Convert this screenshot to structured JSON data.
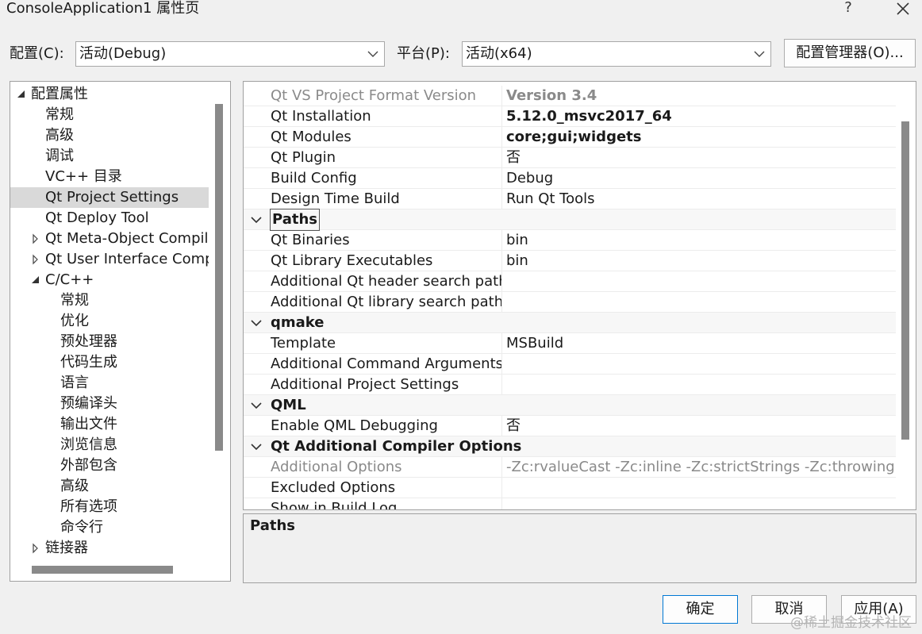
{
  "window": {
    "title": "ConsoleApplication1 属性页",
    "help_label": "?",
    "close_label": "✕"
  },
  "config": {
    "label": "配置(C):",
    "value": "活动(Debug)"
  },
  "platform": {
    "label": "平台(P):",
    "value": "活动(x64)"
  },
  "config_manager_label": "配置管理器(O)...",
  "tree": {
    "items": [
      {
        "label": "配置属性",
        "level": 0,
        "expander": "expanded"
      },
      {
        "label": "常规",
        "level": 1,
        "expander": "none"
      },
      {
        "label": "高级",
        "level": 1,
        "expander": "none"
      },
      {
        "label": "调试",
        "level": 1,
        "expander": "none"
      },
      {
        "label": "VC++ 目录",
        "level": 1,
        "expander": "none"
      },
      {
        "label": "Qt Project Settings",
        "level": 1,
        "expander": "none",
        "selected": true
      },
      {
        "label": "Qt Deploy Tool",
        "level": 1,
        "expander": "none"
      },
      {
        "label": "Qt Meta-Object Compiler",
        "level": 1,
        "expander": "collapsed"
      },
      {
        "label": "Qt User Interface Compiler",
        "level": 1,
        "expander": "collapsed"
      },
      {
        "label": "C/C++",
        "level": 1,
        "expander": "expanded"
      },
      {
        "label": "常规",
        "level": 2,
        "expander": "none"
      },
      {
        "label": "优化",
        "level": 2,
        "expander": "none"
      },
      {
        "label": "预处理器",
        "level": 2,
        "expander": "none"
      },
      {
        "label": "代码生成",
        "level": 2,
        "expander": "none"
      },
      {
        "label": "语言",
        "level": 2,
        "expander": "none"
      },
      {
        "label": "预编译头",
        "level": 2,
        "expander": "none"
      },
      {
        "label": "输出文件",
        "level": 2,
        "expander": "none"
      },
      {
        "label": "浏览信息",
        "level": 2,
        "expander": "none"
      },
      {
        "label": "外部包含",
        "level": 2,
        "expander": "none"
      },
      {
        "label": "高级",
        "level": 2,
        "expander": "none"
      },
      {
        "label": "所有选项",
        "level": 2,
        "expander": "none"
      },
      {
        "label": "命令行",
        "level": 2,
        "expander": "none"
      },
      {
        "label": "链接器",
        "level": 1,
        "expander": "collapsed"
      }
    ]
  },
  "grid": {
    "rows": [
      {
        "type": "prop",
        "name": "Qt VS Project Format Version",
        "value": "Version 3.4",
        "name_style": "gray",
        "value_style": "bold-gray"
      },
      {
        "type": "prop",
        "name": "Qt Installation",
        "value": "5.12.0_msvc2017_64",
        "name_style": "",
        "value_style": "bold"
      },
      {
        "type": "prop",
        "name": "Qt Modules",
        "value": "core;gui;widgets",
        "name_style": "",
        "value_style": "bold"
      },
      {
        "type": "prop",
        "name": "Qt Plugin",
        "value": "否",
        "name_style": "",
        "value_style": ""
      },
      {
        "type": "prop",
        "name": "Build Config",
        "value": "Debug",
        "name_style": "",
        "value_style": ""
      },
      {
        "type": "prop",
        "name": "Design Time Build",
        "value": "Run Qt Tools",
        "name_style": "",
        "value_style": ""
      },
      {
        "type": "cat",
        "name": "Paths",
        "focus": true
      },
      {
        "type": "prop",
        "name": "Qt Binaries",
        "value": "bin",
        "name_style": "",
        "value_style": ""
      },
      {
        "type": "prop",
        "name": "Qt Library Executables",
        "value": "bin",
        "name_style": "",
        "value_style": ""
      },
      {
        "type": "prop",
        "name": "Additional Qt header search paths",
        "value": "",
        "name_style": "",
        "value_style": ""
      },
      {
        "type": "prop",
        "name": "Additional Qt library search paths",
        "value": "",
        "name_style": "",
        "value_style": ""
      },
      {
        "type": "cat",
        "name": "qmake",
        "focus": false
      },
      {
        "type": "prop",
        "name": "Template",
        "value": "MSBuild",
        "name_style": "",
        "value_style": ""
      },
      {
        "type": "prop",
        "name": "Additional Command Arguments",
        "value": "",
        "name_style": "",
        "value_style": ""
      },
      {
        "type": "prop",
        "name": "Additional Project Settings",
        "value": "",
        "name_style": "",
        "value_style": ""
      },
      {
        "type": "cat",
        "name": "QML",
        "focus": false
      },
      {
        "type": "prop",
        "name": "Enable QML Debugging",
        "value": "否",
        "name_style": "",
        "value_style": ""
      },
      {
        "type": "cat",
        "name": "Qt Additional Compiler Options",
        "focus": false
      },
      {
        "type": "prop",
        "name": "Additional Options",
        "value": "-Zc:rvalueCast -Zc:inline -Zc:strictStrings -Zc:throwingNew",
        "name_style": "gray",
        "value_style": "gray"
      },
      {
        "type": "prop",
        "name": "Excluded Options",
        "value": "",
        "name_style": "",
        "value_style": ""
      },
      {
        "type": "prop",
        "name": "Show in Build Log",
        "value": "",
        "name_style": "",
        "value_style": ""
      }
    ]
  },
  "description": {
    "title": "Paths"
  },
  "buttons": {
    "ok": "确定",
    "cancel": "取消",
    "apply": "应用(A)"
  },
  "watermark": "@稀土掘金技术社区"
}
